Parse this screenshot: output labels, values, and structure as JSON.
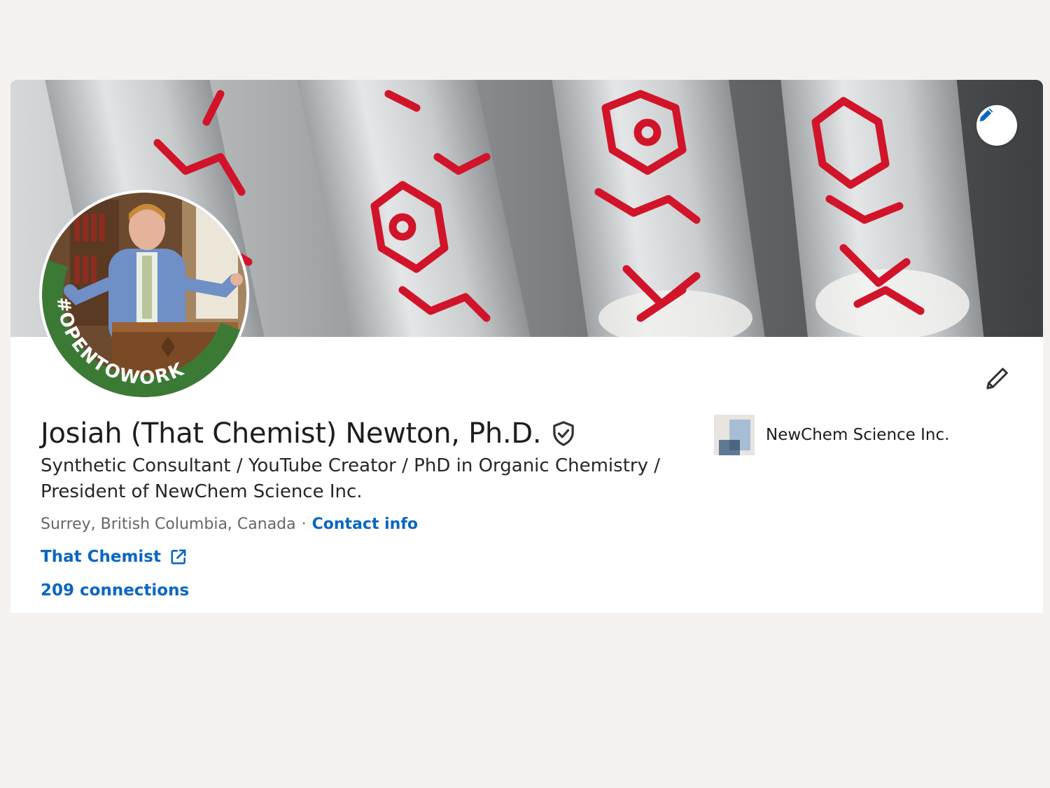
{
  "profile": {
    "name": "Josiah (That Chemist) Newton, Ph.D.",
    "headline": "Synthetic Consultant / YouTube Creator / PhD in Organic Chemistry / President of NewChem Science Inc.",
    "location": "Surrey, British Columbia, Canada",
    "separator": "·",
    "contact_label": "Contact info",
    "website_label": "That Chemist",
    "connections_label": "209 connections",
    "frame_text": "#OPENTOWORK"
  },
  "company": {
    "name": "NewChem Science Inc."
  },
  "icons": {
    "banner_edit": "pencil-icon",
    "profile_edit": "pencil-icon",
    "verification": "shield-check-icon",
    "website_link": "external-link-icon"
  },
  "colors": {
    "link": "#0a66c2",
    "open_to_work_green": "#3b7a35",
    "background": "#f4f1ef"
  }
}
